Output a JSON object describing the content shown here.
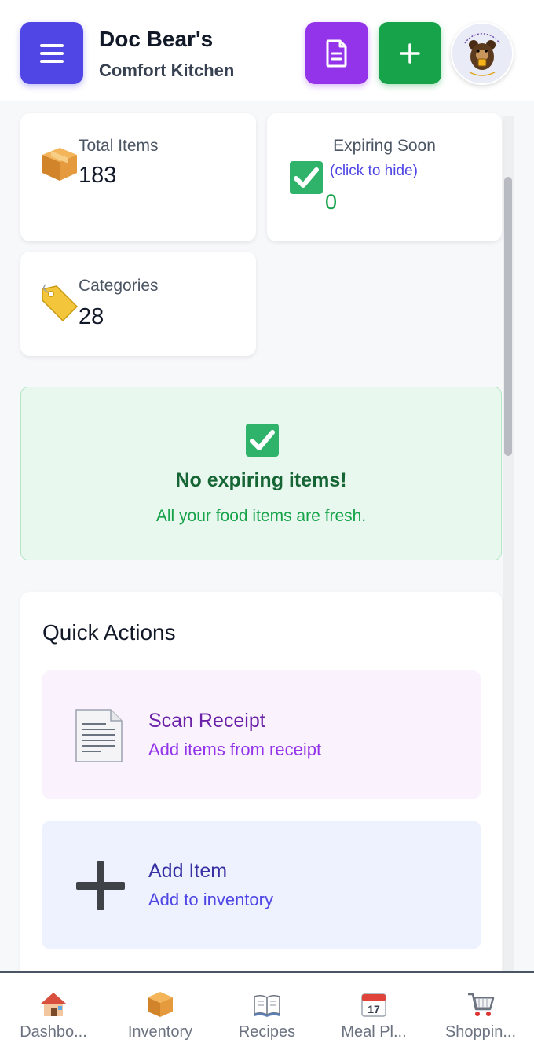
{
  "header": {
    "title": "Doc Bear's",
    "subtitle": "Comfort Kitchen",
    "logo": {
      "ring_text": "Food Care by Doc Bear",
      "tagline": "What Else You?"
    }
  },
  "stats": {
    "total": {
      "label": "Total Items",
      "value": "183",
      "icon": "package-icon"
    },
    "expiring": {
      "label": "Expiring Soon",
      "hint": "(click to hide)",
      "value": "0",
      "icon": "check-mark-icon"
    },
    "categories": {
      "label": "Categories",
      "value": "28",
      "icon": "tag-icon"
    }
  },
  "notice": {
    "title": "No expiring items!",
    "subtitle": "All your food items are fresh."
  },
  "quick_actions": {
    "title": "Quick Actions",
    "items": [
      {
        "title": "Scan Receipt",
        "subtitle": "Add items from receipt",
        "icon": "receipt-icon"
      },
      {
        "title": "Add Item",
        "subtitle": "Add to inventory",
        "icon": "plus-icon"
      }
    ]
  },
  "nav": {
    "items": [
      {
        "label": "Dashbo...",
        "icon": "house-icon"
      },
      {
        "label": "Inventory",
        "icon": "package-icon"
      },
      {
        "label": "Recipes",
        "icon": "book-icon"
      },
      {
        "label": "Meal Pl...",
        "icon": "calendar-icon",
        "badge": "17"
      },
      {
        "label": "Shoppin...",
        "icon": "cart-icon"
      }
    ]
  },
  "colors": {
    "menu": "#4f46e5",
    "document": "#9333ea",
    "add": "#16a34a",
    "notice_bg": "#e8f8ee"
  }
}
